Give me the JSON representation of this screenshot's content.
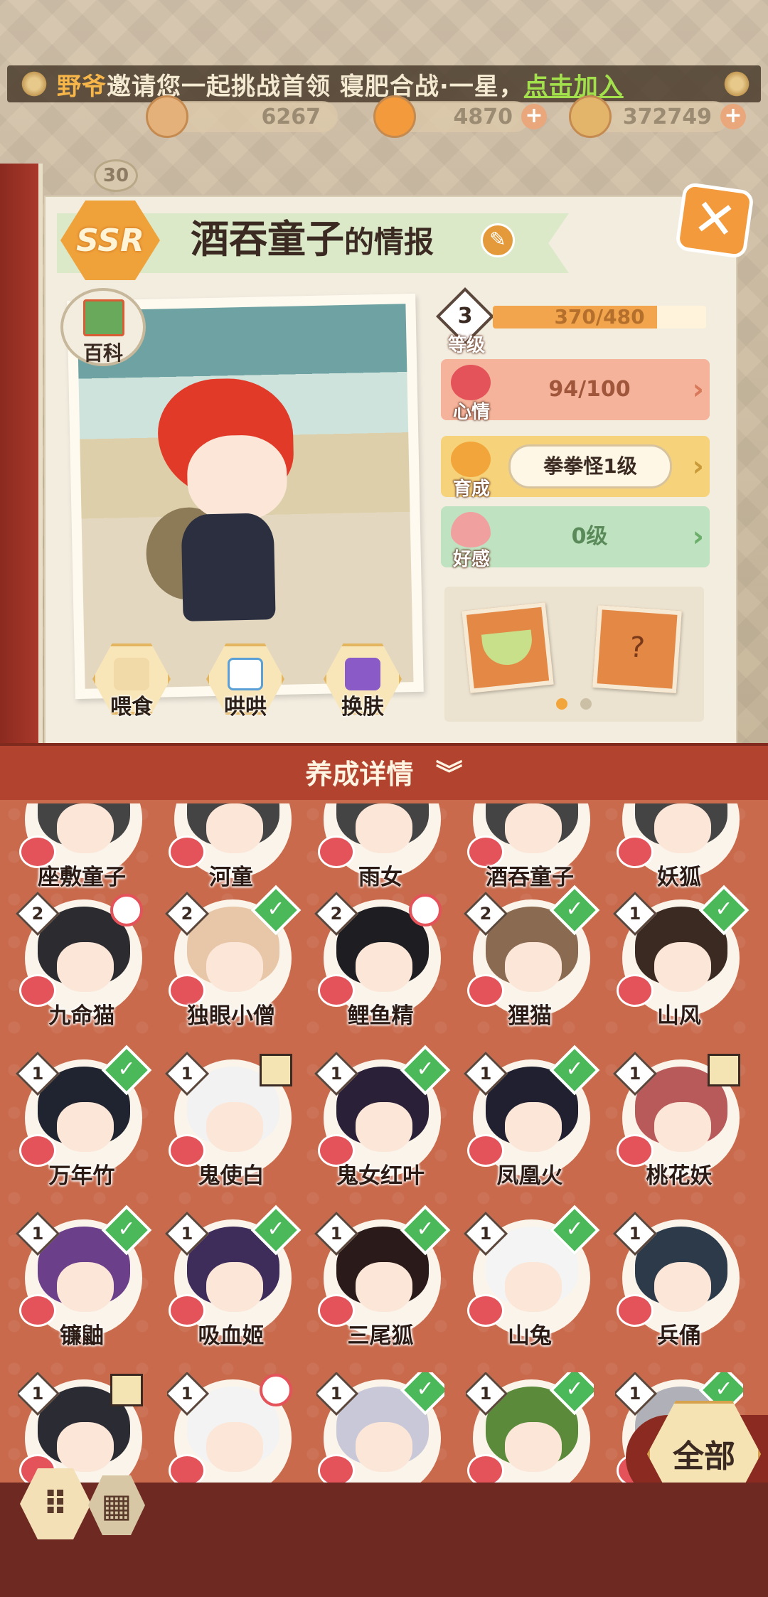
{
  "invite": {
    "inviter": "野爷",
    "message": "邀请您一起挑战首领 寝肥合战·一星，",
    "action": "点击加入"
  },
  "currencies": [
    {
      "icon": "magatama-icon",
      "value": "6267"
    },
    {
      "icon": "jade-icon",
      "value": "4870"
    },
    {
      "icon": "coin-icon",
      "value": "372749"
    }
  ],
  "player": {
    "level": "30"
  },
  "shiki": {
    "rarity": "SSR",
    "name": "酒吞童子",
    "name_suffix": "的情报",
    "wiki_label": "百科",
    "level_label": "等级",
    "level": "3",
    "exp_text": "370/480",
    "exp_fraction": 0.77,
    "mood_label": "心情",
    "mood_value": "94/100",
    "nurture_label": "育成",
    "nurture_value": "拳拳怪1级",
    "affinity_label": "好感",
    "affinity_value": "0级"
  },
  "actions": [
    {
      "name": "feed-button",
      "label": "喂食"
    },
    {
      "name": "coax-button",
      "label": "哄哄"
    },
    {
      "name": "skin-button",
      "label": "换肤"
    }
  ],
  "gifts_page": {
    "pages": 2,
    "current": 0
  },
  "detail_bar": {
    "label": "养成详情",
    "arrow": "︾"
  },
  "grid_rows": {
    "row1": [
      {
        "name": "座敷童子"
      },
      {
        "name": "河童"
      },
      {
        "name": "雨女"
      },
      {
        "name": "酒吞童子"
      },
      {
        "name": "妖狐"
      }
    ]
  },
  "shikigami": [
    {
      "name": "九命猫",
      "level": "2",
      "badge": "note",
      "hair": "#2b2b30"
    },
    {
      "name": "独眼小僧",
      "level": "2",
      "badge": "check",
      "hair": "#e8c7a8"
    },
    {
      "name": "鲤鱼精",
      "level": "2",
      "badge": "note",
      "hair": "#1d1d22"
    },
    {
      "name": "狸猫",
      "level": "2",
      "badge": "check",
      "hair": "#8a6a50"
    },
    {
      "name": "山风",
      "level": "1",
      "badge": "check",
      "hair": "#3a2a22"
    },
    {
      "name": "万年竹",
      "level": "1",
      "badge": "check",
      "hair": "#1f2430"
    },
    {
      "name": "鬼使白",
      "level": "1",
      "badge": "gift",
      "hair": "#f2f2f2"
    },
    {
      "name": "鬼女红叶",
      "level": "1",
      "badge": "check",
      "hair": "#2a2038"
    },
    {
      "name": "凤凰火",
      "level": "1",
      "badge": "check",
      "hair": "#202030"
    },
    {
      "name": "桃花妖",
      "level": "1",
      "badge": "gift",
      "hair": "#b85a5a"
    },
    {
      "name": "镰鼬",
      "level": "1",
      "badge": "check",
      "hair": "#6b3f8a"
    },
    {
      "name": "吸血姬",
      "level": "1",
      "badge": "check",
      "hair": "#3e2c5a"
    },
    {
      "name": "三尾狐",
      "level": "1",
      "badge": "check",
      "hair": "#2a1a1a"
    },
    {
      "name": "山兔",
      "level": "1",
      "badge": "check",
      "hair": "#f4f4f4"
    },
    {
      "name": "兵俑",
      "level": "1",
      "badge": "none",
      "hair": "#2c3a4a"
    },
    {
      "name": "",
      "level": "1",
      "badge": "gift",
      "hair": "#2b2b33"
    },
    {
      "name": "",
      "level": "1",
      "badge": "note",
      "hair": "#f3f3f3"
    },
    {
      "name": "",
      "level": "1",
      "badge": "check",
      "hair": "#c8c8d8"
    },
    {
      "name": "",
      "level": "1",
      "badge": "check",
      "hair": "#5a8a3a"
    },
    {
      "name": "",
      "level": "1",
      "badge": "check",
      "hair": "#b0b0b8"
    }
  ],
  "filter": {
    "label": "全部"
  },
  "view_toggles": [
    {
      "name": "grid-view-button",
      "glyph": "⠿"
    },
    {
      "name": "list-view-button",
      "glyph": "▦"
    }
  ],
  "colors": {
    "accent_orange": "#f2a54c",
    "mood_pink": "#f5b39b",
    "nurture_yellow": "#f6d37a",
    "affinity_green": "#bfe2c0",
    "grid_bg": "#c96a4c",
    "check_green": "#4bb85a"
  }
}
